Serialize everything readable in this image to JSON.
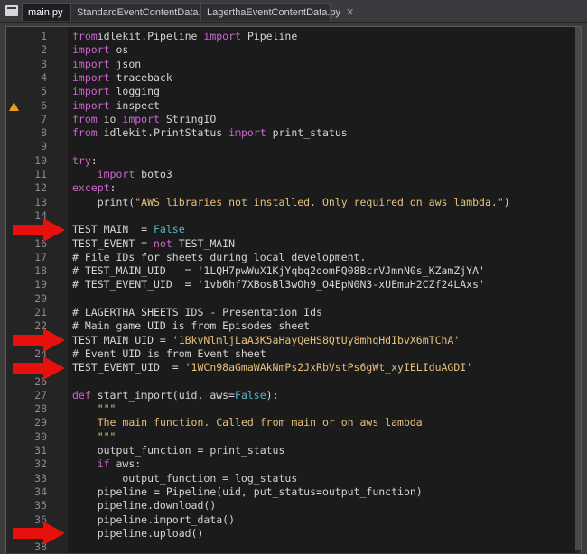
{
  "tabs": [
    {
      "label": "main.py",
      "close": "✕",
      "active": true
    },
    {
      "label": "StandardEventContentData.py",
      "close": "✕",
      "active": false
    },
    {
      "label": "LagerthaEventContentData.py",
      "close": "✕",
      "active": false
    }
  ],
  "colors": {
    "keyword": "#cc66cc",
    "string": "#e6c07b",
    "constant": "#56b6c2",
    "text": "#d4d4d4",
    "arrow": "#e8100c",
    "warning": "#f0a020"
  },
  "editor": {
    "lines": [
      {
        "n": "1",
        "t": [
          [
            "kw",
            "from"
          ],
          [
            "",
            "idlekit.Pipeline "
          ],
          [
            "kw",
            "import"
          ],
          [
            "",
            " Pipeline"
          ]
        ]
      },
      {
        "n": "2",
        "t": [
          [
            "kw",
            "import"
          ],
          [
            "",
            " os"
          ]
        ]
      },
      {
        "n": "3",
        "t": [
          [
            "kw",
            "import"
          ],
          [
            "",
            " json"
          ]
        ]
      },
      {
        "n": "4",
        "t": [
          [
            "kw",
            "import"
          ],
          [
            "",
            " traceback"
          ]
        ]
      },
      {
        "n": "5",
        "t": [
          [
            "kw",
            "import"
          ],
          [
            "",
            " logging"
          ]
        ]
      },
      {
        "n": "6",
        "t": [
          [
            "kw",
            "import"
          ],
          [
            "",
            " inspect"
          ]
        ],
        "warn": true
      },
      {
        "n": "7",
        "t": [
          [
            "kw",
            "from"
          ],
          [
            "",
            " io "
          ],
          [
            "kw",
            "import"
          ],
          [
            "",
            " StringIO"
          ]
        ]
      },
      {
        "n": "8",
        "t": [
          [
            "kw",
            "from"
          ],
          [
            "",
            " idlekit.PrintStatus "
          ],
          [
            "kw",
            "import"
          ],
          [
            "",
            " print_status"
          ]
        ]
      },
      {
        "n": "9",
        "t": []
      },
      {
        "n": "10",
        "t": [
          [
            "kw",
            "try"
          ],
          [
            "",
            ":"
          ]
        ]
      },
      {
        "n": "11",
        "t": [
          [
            "",
            "    "
          ],
          [
            "kw",
            "import"
          ],
          [
            "",
            " boto3"
          ]
        ]
      },
      {
        "n": "12",
        "t": [
          [
            "kw",
            "except"
          ],
          [
            "",
            ":"
          ]
        ]
      },
      {
        "n": "13",
        "t": [
          [
            "",
            "    print("
          ],
          [
            "str",
            "\"AWS libraries not installed. Only required on aws lambda.\""
          ],
          [
            "",
            ")"
          ]
        ]
      },
      {
        "n": "14",
        "t": []
      },
      {
        "n": "15",
        "t": [
          [
            "",
            "TEST_MAIN  = "
          ],
          [
            "const",
            "False"
          ]
        ]
      },
      {
        "n": "16",
        "t": [
          [
            "",
            "TEST_EVENT = "
          ],
          [
            "kw",
            "not"
          ],
          [
            "",
            " TEST_MAIN"
          ]
        ]
      },
      {
        "n": "17",
        "t": [
          [
            "com",
            "# File IDs for sheets during local development."
          ]
        ]
      },
      {
        "n": "18",
        "t": [
          [
            "com",
            "# TEST_MAIN_UID   = '1LQH7pwWuX1KjYqbq2oomFQ08BcrVJmnN0s_KZamZjYA'"
          ]
        ]
      },
      {
        "n": "19",
        "t": [
          [
            "com",
            "# TEST_EVENT_UID  = '1vb6hf7XBosBl3wOh9_O4EpN0N3-xUEmuH2CZf24LAxs'"
          ]
        ]
      },
      {
        "n": "20",
        "t": []
      },
      {
        "n": "21",
        "t": [
          [
            "com",
            "# LAGERTHA SHEETS IDS - Presentation Ids"
          ]
        ]
      },
      {
        "n": "22",
        "t": [
          [
            "com",
            "# Main game UID is from Episodes sheet"
          ]
        ]
      },
      {
        "n": "23",
        "t": [
          [
            "",
            "TEST_MAIN_UID = "
          ],
          [
            "str",
            "'1BkvNlmljLaA3K5aHayQeHS8QtUy8mhqHdIbvX6mTChA'"
          ]
        ]
      },
      {
        "n": "24",
        "t": [
          [
            "com",
            "# Event UID is from Event sheet"
          ]
        ]
      },
      {
        "n": "25",
        "t": [
          [
            "",
            "TEST_EVENT_UID  = "
          ],
          [
            "str",
            "'1WCn98aGmaWAkNmPs2JxRbVstPs6gWt_xyIELIduAGDI'"
          ]
        ]
      },
      {
        "n": "26",
        "t": []
      },
      {
        "n": "27",
        "t": [
          [
            "kw",
            "def"
          ],
          [
            "",
            " start_import(uid, aws="
          ],
          [
            "const",
            "False"
          ],
          [
            "",
            "):"
          ]
        ]
      },
      {
        "n": "28",
        "t": [
          [
            "",
            "    "
          ],
          [
            "doc",
            "\"\"\""
          ]
        ]
      },
      {
        "n": "29",
        "t": [
          [
            "",
            "    "
          ],
          [
            "doc",
            "The main function. Called from main or on aws lambda"
          ]
        ]
      },
      {
        "n": "30",
        "t": [
          [
            "",
            "    "
          ],
          [
            "doc",
            "\"\"\""
          ]
        ]
      },
      {
        "n": "31",
        "t": [
          [
            "",
            "    output_function = print_status"
          ]
        ]
      },
      {
        "n": "32",
        "t": [
          [
            "",
            "    "
          ],
          [
            "kw",
            "if"
          ],
          [
            "",
            " aws:"
          ]
        ]
      },
      {
        "n": "33",
        "t": [
          [
            "",
            "        output_function = log_status"
          ]
        ]
      },
      {
        "n": "34",
        "t": [
          [
            "",
            "    pipeline = Pipeline(uid, put_status=output_function)"
          ]
        ]
      },
      {
        "n": "35",
        "t": [
          [
            "",
            "    pipeline.download()"
          ]
        ]
      },
      {
        "n": "36",
        "t": [
          [
            "",
            "    pipeline.import_data()"
          ]
        ]
      },
      {
        "n": "37",
        "t": [
          [
            "",
            "    pipeline.upload()"
          ]
        ]
      },
      {
        "n": "38",
        "t": []
      }
    ]
  },
  "annotations": [
    {
      "name": "red-arrow-line-15",
      "line": "15"
    },
    {
      "name": "red-arrow-line-23",
      "line": "23"
    },
    {
      "name": "red-arrow-line-25",
      "line": "25"
    },
    {
      "name": "red-arrow-line-37",
      "line": "37"
    }
  ]
}
